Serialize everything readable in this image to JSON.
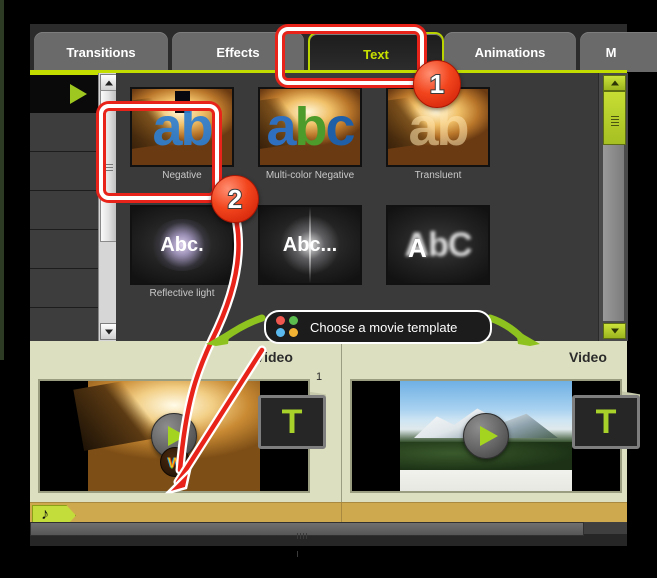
{
  "tabs": [
    {
      "label": "Transitions",
      "selected": false
    },
    {
      "label": "Effects",
      "selected": false
    },
    {
      "label": "Text",
      "selected": true
    },
    {
      "label": "Animations",
      "selected": false
    },
    {
      "label": "M",
      "selected": false
    }
  ],
  "effects_grid": {
    "items": [
      {
        "label": "Negative",
        "selected": true,
        "art": "ab"
      },
      {
        "label": "Multi-color Negative",
        "selected": false,
        "art": "abc"
      },
      {
        "label": "Transluent",
        "selected": false,
        "art": "ab-translucent"
      },
      {
        "label": "Reflective light",
        "selected": false,
        "art": "Abc."
      },
      {
        "label": "",
        "selected": false,
        "art": "Abc..."
      },
      {
        "label": "",
        "selected": false,
        "art": "AbC"
      }
    ]
  },
  "scrollbars": {
    "left_panel": {
      "up_icon": "caret-up-icon",
      "down_icon": "caret-down-icon",
      "grip_icon": "grip-icon"
    },
    "right_panel": {
      "up_icon": "caret-up-icon",
      "down_icon": "caret-down-icon",
      "grip_icon": "grip-icon"
    },
    "bottom": {
      "grip_icon": "grip-icon"
    }
  },
  "timeline": {
    "clips": [
      {
        "track_label": "Video",
        "track_number": "1",
        "preview": "wheat-field",
        "play_icon": "play-icon",
        "effect_icon": "fx-icon",
        "text_button": "T"
      },
      {
        "track_label": "Video",
        "track_number": "",
        "preview": "snow-mountain",
        "play_icon": "play-icon",
        "effect_icon": "",
        "text_button": "T"
      }
    ],
    "audio_track": {
      "icon": "music-note-icon"
    }
  },
  "annotations": {
    "badges": [
      {
        "number": "1",
        "target": "tab-text"
      },
      {
        "number": "2",
        "target": "effect-negative"
      }
    ],
    "tooltip": {
      "text": "Choose a movie template",
      "icon": "four-dots-icon"
    },
    "highlight_color": "#e8231a",
    "arrow_color_red": "#e8231a",
    "arrow_color_green": "#8ec21f"
  },
  "colors": {
    "accent_green": "#c3dd00",
    "tab_bar_bg": "#2b2b2b",
    "panel_bg": "#3a3a3a",
    "timeline_bg": "#dde0c0",
    "audio_bar": "#cfa94e",
    "badge_red": "#f2441c"
  }
}
